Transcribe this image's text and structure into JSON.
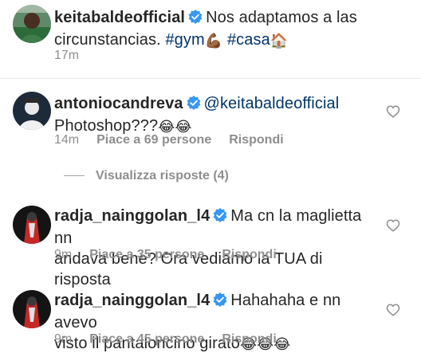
{
  "post": {
    "username": "keitabaldeofficial",
    "caption_line1": "Nos adaptamos a las",
    "caption_line2_prefix": "circunstancias.",
    "hashtag1": "#gym",
    "hashtag1_emoji": "💪🏾",
    "hashtag2": "#casa",
    "hashtag2_emoji": "🏠",
    "time": "17m"
  },
  "comments": [
    {
      "username": "antoniocandreva",
      "line1": "@keitabaldeofficial",
      "line2": "Photoshop???",
      "emoji": "😂😂",
      "time": "14m",
      "likes": "Piace a 69 persone",
      "reply": "Rispondi"
    },
    {
      "username": "radja_nainggolan_l4",
      "line1": "Ma cn la maglietta nn",
      "line2": "andava bene? Ora vediamo la TUA di risposta",
      "emoji": "",
      "time": "9m",
      "likes": "Piace a 35 persone",
      "reply": "Rispondi"
    },
    {
      "username": "radja_nainggolan_l4",
      "line1": "Hahahaha e nn avevo",
      "line2": "visto il pantaloncino girato",
      "emoji": "😂😂😂",
      "time": "9m",
      "likes": "Piace a 45 persone",
      "reply": "Rispondi"
    }
  ],
  "view_replies": "Visualizza risposte (4)",
  "colors": {
    "text": "#262626",
    "secondary": "#8e8e8e",
    "hashtag": "#003569",
    "verified": "#3897f0"
  }
}
